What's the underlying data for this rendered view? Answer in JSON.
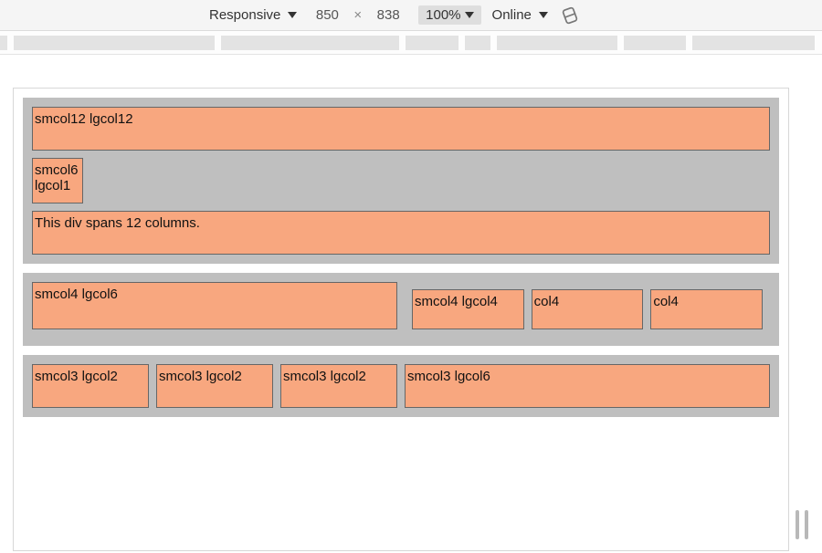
{
  "toolbar": {
    "device_mode": "Responsive",
    "width": "850",
    "height": "838",
    "zoom": "100%",
    "throttling": "Online"
  },
  "grid": {
    "row1": {
      "a": "smcol12 lgcol12",
      "b_line1": "smcol6",
      "b_line2": "lgcol1",
      "c": "This div spans 12 columns."
    },
    "row2": {
      "a": "smcol4 lgcol6",
      "nested": {
        "a": "smcol4 lgcol4",
        "b": "col4",
        "c": "col4"
      }
    },
    "row3": {
      "a": "smcol3 lgcol2",
      "b": "smcol3 lgcol2",
      "c": "smcol3 lgcol2",
      "d": "smcol3 lgcol6"
    }
  }
}
